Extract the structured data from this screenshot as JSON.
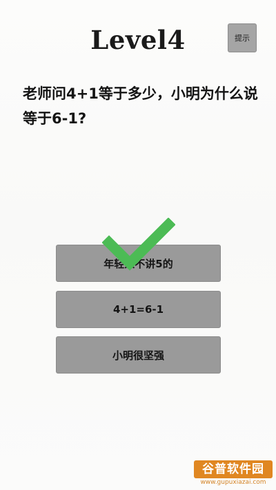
{
  "header": {
    "level_title": "Level4",
    "hint_label": "提示"
  },
  "question": {
    "text": "老师问4+1等于多少，小明为什么说等于6-1?"
  },
  "answers": [
    {
      "label": "年轻人不讲5的",
      "selected": true
    },
    {
      "label": "4+1=6-1",
      "selected": false
    },
    {
      "label": "小明很坚强",
      "selected": false
    }
  ],
  "feedback": {
    "icon": "check-mark-icon",
    "color": "#4cbb55"
  },
  "watermark": {
    "name": "谷普软件园",
    "url": "www.gupuxiazai.com"
  }
}
